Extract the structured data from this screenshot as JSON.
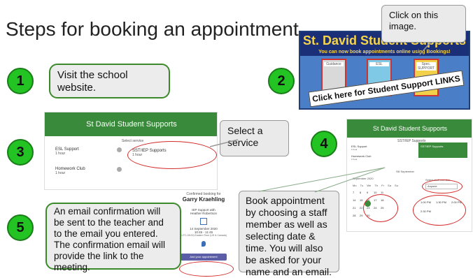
{
  "title": "Steps for booking an appointment",
  "steps": {
    "s1": "1",
    "s2": "2",
    "s3": "3",
    "s4": "4",
    "s5": "5"
  },
  "callouts": {
    "visit": "Visit the school website.",
    "click_image": "Click on this image.",
    "select_service": "Select a service",
    "email_confirm": "An email confirmation will be sent to the teacher and to the email you entered.  The confirmation email will provide the link to the meeting.",
    "book": "Book appointment by choosing a staff member as well as selecting date & time. You will also be asked for your name and an email."
  },
  "banner": {
    "title": "St. David Student Supports",
    "subtitle": "You can now book appointments online using Bookings!",
    "doors": [
      "Guidance",
      "ESL",
      "Spec. SUPPORT"
    ],
    "cta": "Click here for Student Support LINKS"
  },
  "shot3": {
    "header": "St David Student Supports",
    "select_label": "Select service",
    "services": [
      {
        "name": "ESL Support",
        "meta": "1 hour"
      },
      {
        "name": "Homework Club",
        "meta": "1 hour"
      },
      {
        "name": "SST/IEP Supports",
        "meta": "1 hour"
      }
    ]
  },
  "shot4": {
    "header": "St David Student Supports",
    "sub": "SST/IEP Supports",
    "services": [
      {
        "name": "ESL Support",
        "meta": "1 hour"
      },
      {
        "name": "Homework Club",
        "meta": "1 hour"
      },
      {
        "name": "SST/IEP Supports",
        "meta": "1 hour"
      }
    ],
    "month": "September 2020",
    "calendar_label": "Sill September",
    "staff_label": "Select staff member",
    "staff_value": "Anyone",
    "weekdays": [
      "Mo",
      "Tu",
      "We",
      "Th",
      "Fr",
      "Sa",
      "Su"
    ],
    "days": [
      "7",
      "8",
      "9",
      "10",
      "11",
      "14",
      "15",
      "16",
      "17",
      "18",
      "21",
      "22",
      "23",
      "24",
      "25",
      "28",
      "29",
      "30"
    ],
    "times": [
      "1:00 PM",
      "1:30 PM",
      "2:00 PM",
      "2:30 PM"
    ]
  },
  "shot5": {
    "heading": "Confirmed booking for",
    "name": "Garry Kraehling",
    "service": "IEP Support with Heather Robertson",
    "date": "14 September 2020",
    "time": "10:45 - 11:45",
    "tz": "(UTC-05:00) Eastern Time (US & Canada)",
    "button": "Add your appointment"
  },
  "colors": {
    "accent_green": "#22c322",
    "header_green": "#3a8a3c",
    "annotation_red": "#d42a2a"
  }
}
